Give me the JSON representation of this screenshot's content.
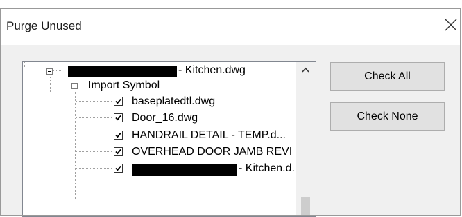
{
  "dialog": {
    "title": "Purge Unused",
    "close_glyph": "X"
  },
  "tree": {
    "root": {
      "label_suffix": "- Kitchen.dwg",
      "expander_state": "expanded",
      "redacted": true
    },
    "group": {
      "label": "Import Symbol",
      "expander_state": "expanded"
    },
    "items": [
      {
        "label": "baseplatedtl.dwg",
        "checked": true
      },
      {
        "label": "Door_16.dwg",
        "checked": true
      },
      {
        "label": "HANDRAIL DETAIL - TEMP.d...",
        "checked": true
      },
      {
        "label": "OVERHEAD DOOR JAMB REVI",
        "checked": true
      },
      {
        "label_suffix": "- Kitchen.d...",
        "checked": true,
        "redacted": true
      }
    ]
  },
  "buttons": {
    "check_all": "Check All",
    "check_none": "Check None"
  },
  "icons": {
    "close": "close-icon",
    "expand": "collapse-minus-icon",
    "checkbox": "checkmark-icon",
    "scroll_up": "chevron-up-icon"
  },
  "colors": {
    "dialog_body": "#f0f0f0",
    "button_face": "#e1e1e1",
    "tree_border": "#828790"
  }
}
